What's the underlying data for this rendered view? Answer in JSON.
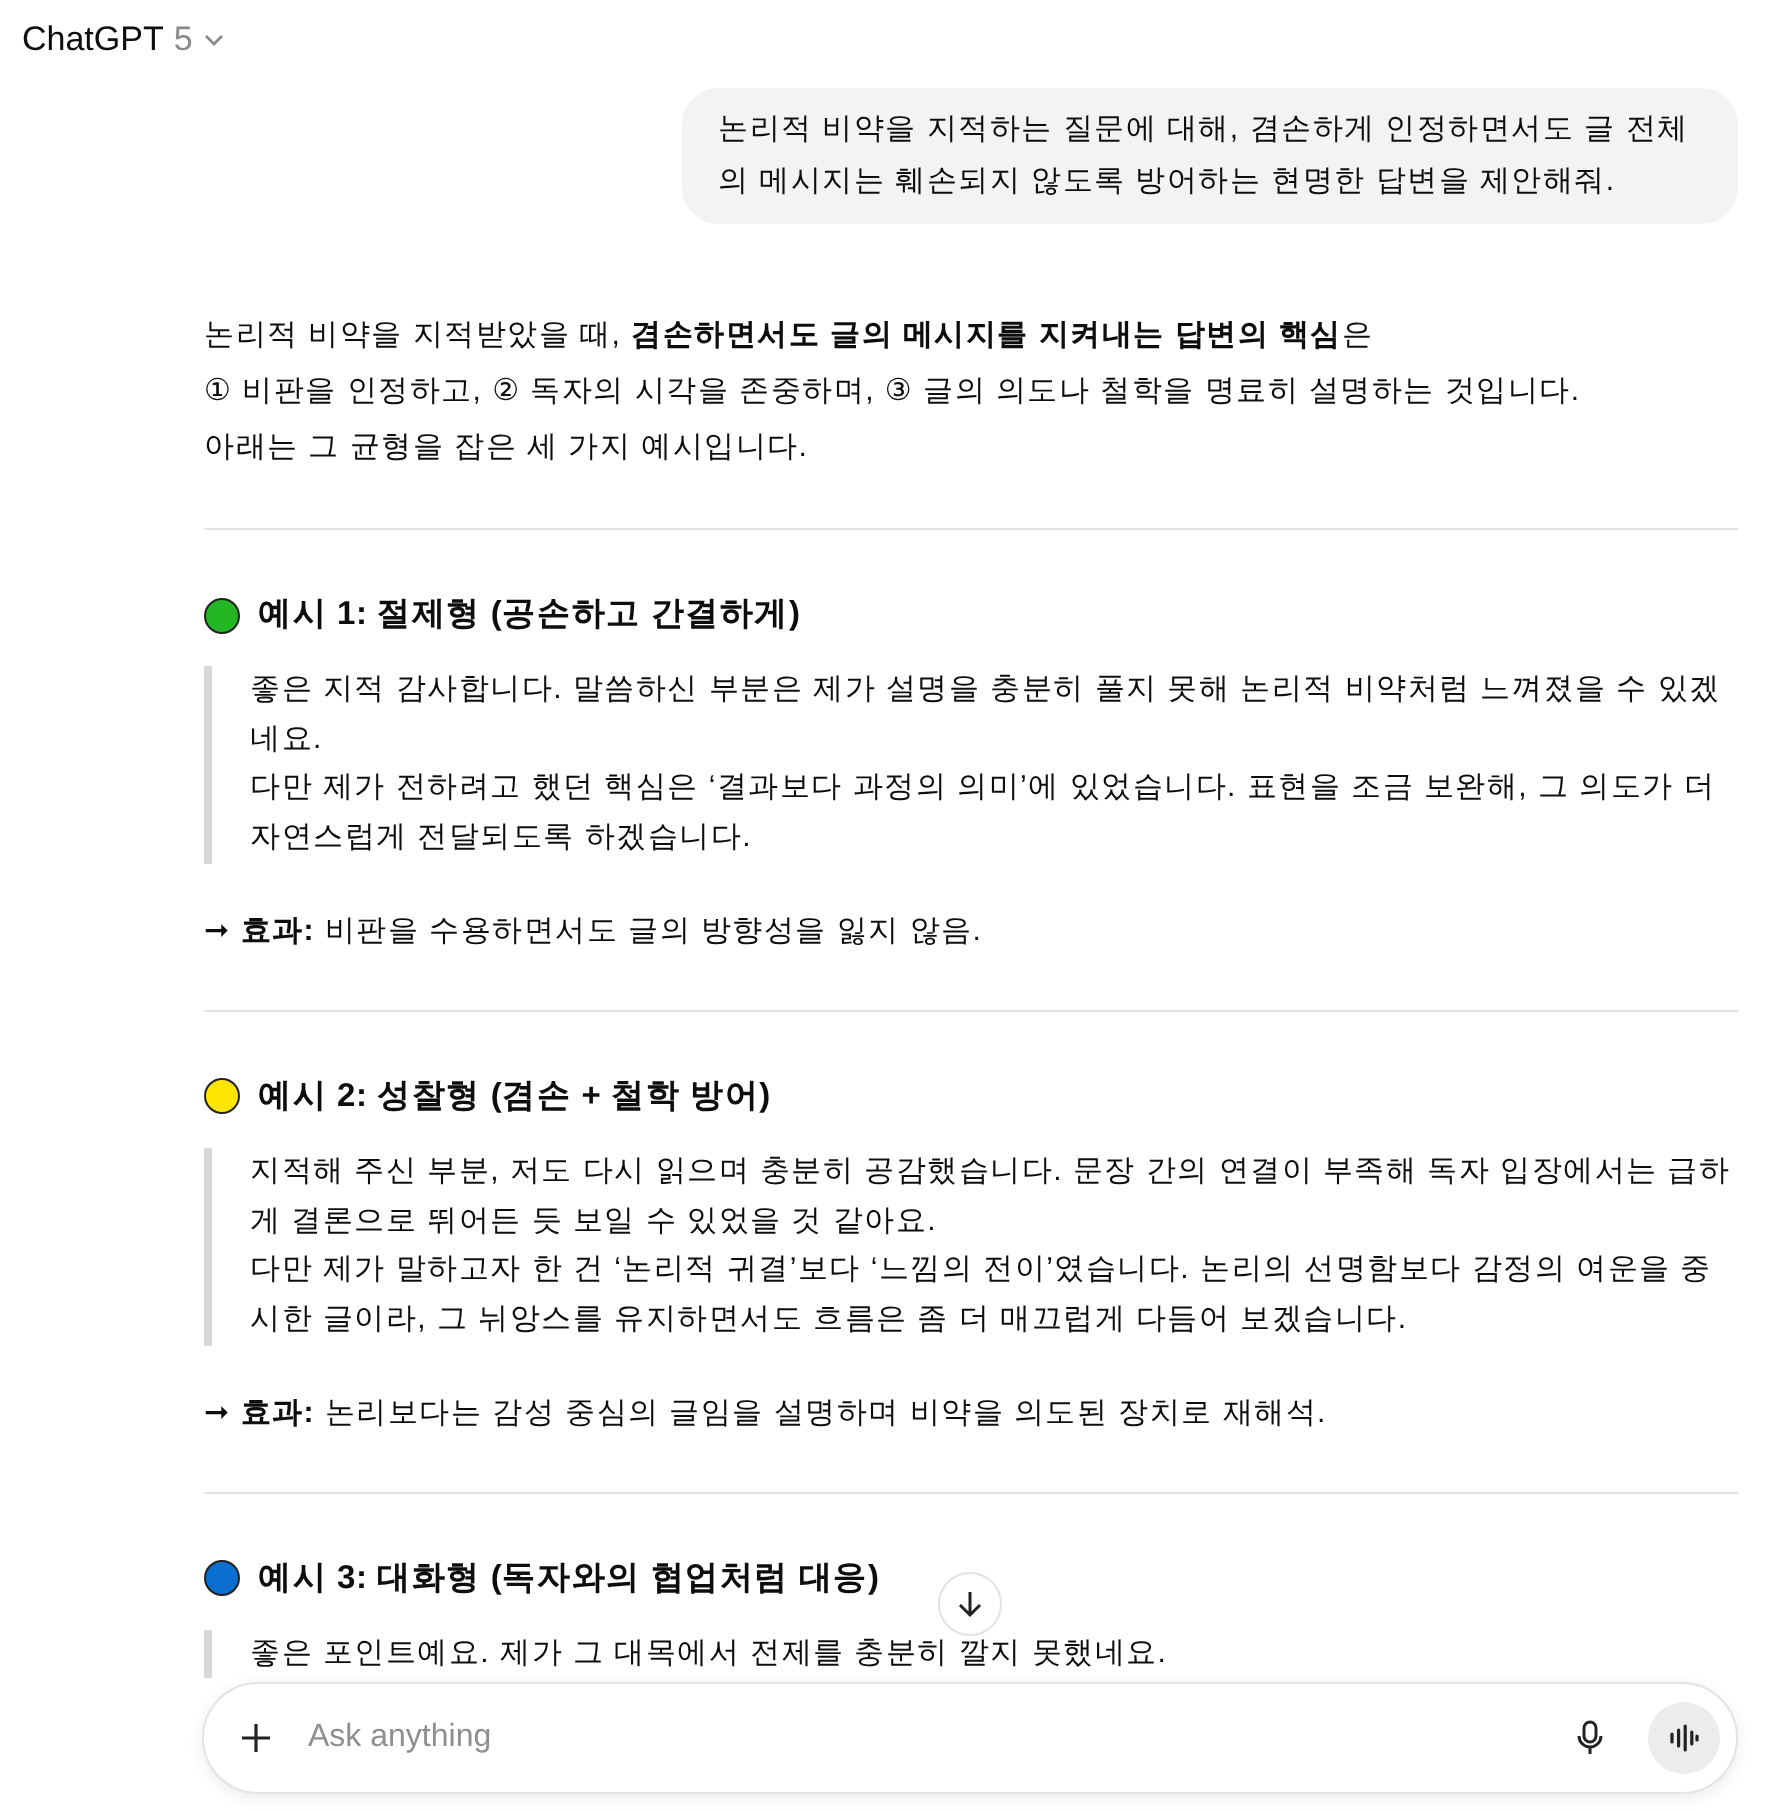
{
  "header": {
    "title": "ChatGPT",
    "version": "5"
  },
  "user_message": "논리적 비약을 지적하는 질문에 대해, 겸손하게 인정하면서도 글 전체의 메시지는 훼손되지 않도록 방어하는 현명한 답변을 제안해줘.",
  "intro": [
    "논리적 비약을 지적받았을 때, **겸손하면서도 글의 메시지를 지켜내는 답변의 핵심**은",
    "① 비판을 인정하고, ② 독자의 시각을 존중하며, ③ 글의 의도나 철학을 명료히 설명하는 것입니다.",
    "아래는 그 균형을 잡은 세 가지 예시입니다."
  ],
  "sections": [
    {
      "color": "#22b722",
      "title": "예시 1: 절제형 (공손하고 간결하게)",
      "quote": [
        "좋은 지적 감사합니다. 말씀하신 부분은 제가 설명을 충분히 풀지 못해 논리적 비약처럼 느껴졌을 수 있겠네요.",
        "다만 제가 전하려고 했던 핵심은 ‘결과보다 과정의 의미’에 있었습니다. 표현을 조금 보완해, 그 의도가 더 자연스럽게 전달되도록 하겠습니다."
      ],
      "effect": "➞ **효과:** 비판을 수용하면서도 글의 방향성을 잃지 않음."
    },
    {
      "color": "#ffe500",
      "title": "예시 2: 성찰형 (겸손 + 철학 방어)",
      "quote": [
        "지적해 주신 부분, 저도 다시 읽으며 충분히 공감했습니다. 문장 간의 연결이 부족해 독자 입장에서는 급하게 결론으로 뛰어든 듯 보일 수 있었을 것 같아요.",
        "다만 제가 말하고자 한 건 ‘논리적 귀결’보다 ‘느낌의 전이’였습니다. 논리의 선명함보다 감정의 여운을 중시한 글이라, 그 뉘앙스를 유지하면서도 흐름은 좀 더 매끄럽게 다듬어 보겠습니다."
      ],
      "effect": "➞ **효과:** 논리보다는 감성 중심의 글임을 설명하며 비약을 의도된 장치로 재해석."
    },
    {
      "color": "#0b6fd0",
      "title": "예시 3: 대화형 (독자와의 협업처럼 대응)",
      "quote": [
        "좋은 포인트예요. 제가 그 대목에서 전제를 충분히 깔지 못했네요."
      ]
    }
  ],
  "composer": {
    "placeholder": "Ask anything"
  }
}
